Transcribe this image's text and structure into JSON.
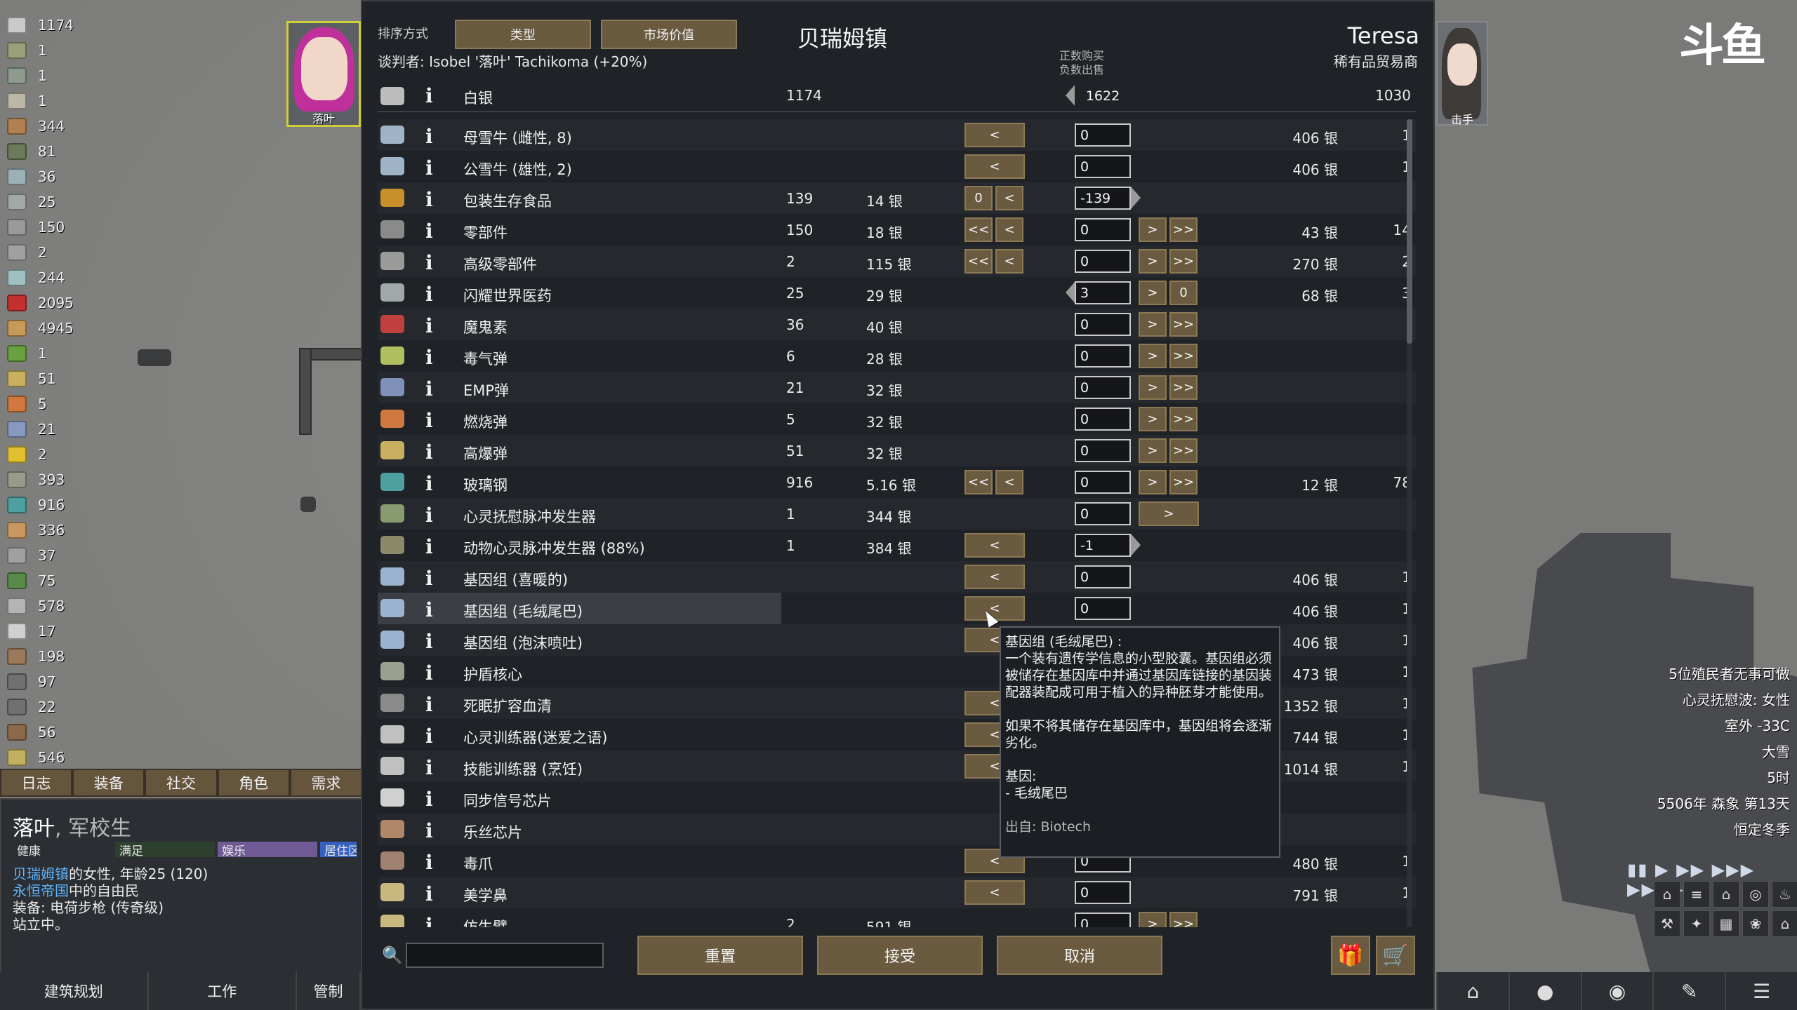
{
  "resources": [
    {
      "value": "1174",
      "icon": "silver-icon",
      "color": "#c9c9c9"
    },
    {
      "value": "1",
      "icon": "shield-belt-icon",
      "color": "#9aa07a"
    },
    {
      "value": "1",
      "icon": "helmet-icon",
      "color": "#8e9a8e"
    },
    {
      "value": "1",
      "icon": "blade-icon",
      "color": "#bdb7a8"
    },
    {
      "value": "344",
      "icon": "meat-icon",
      "color": "#b08050"
    },
    {
      "value": "81",
      "icon": "textile-icon",
      "color": "#6a7a5a"
    },
    {
      "value": "36",
      "icon": "medicine-icon",
      "color": "#9bb0b5"
    },
    {
      "value": "25",
      "icon": "glitter-medicine-icon",
      "color": "#a0a8a8"
    },
    {
      "value": "150",
      "icon": "component-icon",
      "color": "#9a9a9a"
    },
    {
      "value": "2",
      "icon": "advanced-component-icon",
      "color": "#a0a0a0"
    },
    {
      "value": "244",
      "icon": "vial-icon",
      "color": "#9fc0c0"
    },
    {
      "value": "2095",
      "icon": "rice-icon",
      "color": "#c23030"
    },
    {
      "value": "4945",
      "icon": "wood-icon",
      "color": "#c79a58"
    },
    {
      "value": "1",
      "icon": "plant-icon",
      "color": "#6aa040"
    },
    {
      "value": "51",
      "icon": "shell-icon",
      "color": "#c8b060"
    },
    {
      "value": "5",
      "icon": "incendiary-shell-icon",
      "color": "#d07840"
    },
    {
      "value": "21",
      "icon": "emp-shell-icon",
      "color": "#8899c0"
    },
    {
      "value": "2",
      "icon": "gold-icon",
      "color": "#e0c030"
    },
    {
      "value": "393",
      "icon": "stone-block-icon",
      "color": "#9a9a8a"
    },
    {
      "value": "916",
      "icon": "plasteel-icon",
      "color": "#4ea0a0"
    },
    {
      "value": "336",
      "icon": "steel-icon",
      "color": "#c89860"
    },
    {
      "value": "37",
      "icon": "bone-icon",
      "color": "#a0a0a0"
    },
    {
      "value": "75",
      "icon": "herbal-icon",
      "color": "#5a8a4a"
    },
    {
      "value": "578",
      "icon": "steel-bar-icon",
      "color": "#b4b4b4"
    },
    {
      "value": "17",
      "icon": "uranium-icon",
      "color": "#d0d0d0"
    },
    {
      "value": "198",
      "icon": "rifle-icon",
      "color": "#9a7a5a"
    },
    {
      "value": "97",
      "icon": "pistol-icon",
      "color": "#707070"
    },
    {
      "value": "22",
      "icon": "knife-icon",
      "color": "#707070"
    },
    {
      "value": "56",
      "icon": "club-icon",
      "color": "#8a6a4a"
    },
    {
      "value": "546",
      "icon": "chemfuel-icon",
      "color": "#c0b060"
    }
  ],
  "left_portrait": {
    "tag": "落叶"
  },
  "left_tabs": [
    "日志",
    "装备",
    "社交",
    "角色",
    "需求"
  ],
  "inspect": {
    "name": "落叶",
    "title": ", 军校生",
    "bars": [
      {
        "label": "健康",
        "color": "#3a4e3a"
      },
      {
        "label": "满足",
        "color": "#2d3f2f"
      },
      {
        "label": "娱乐",
        "color": "#6f5a95"
      },
      {
        "label": "居住区",
        "color": "#3560c0"
      }
    ],
    "line1_link": "贝瑞姆镇",
    "line1_rest": "的女性, 年龄25 (120)",
    "line2_link": "永恒帝国",
    "line2_rest": "中的自由民",
    "line3": "装备: 电荷步枪 (传奇级)",
    "line4": "站立中。"
  },
  "bottom_left": [
    "建筑规划",
    "工作",
    "管制"
  ],
  "right_portrait_tag": "击手",
  "watermark": "斗鱼",
  "alerts": [
    "5位殖民者无事可做",
    "心灵抚慰波: 女性",
    "室外 -33C",
    "大雪",
    "5时",
    "5506年 森象 第13天",
    "恒定冬季"
  ],
  "speed_controls": "▮▮  ▶  ▶▶  ▶▶▶  ▶▶▶▶",
  "trade": {
    "sort_label": "排序方式",
    "sort_buttons": [
      "类型",
      "市场价值"
    ],
    "town": "贝瑞姆镇",
    "negotiator": "谈判者: Isobel '落叶' Tachikoma (+20%)",
    "trader_name": "Teresa",
    "trader_type": "稀有品贸易商",
    "hint_line1": "正数购买",
    "hint_line2": "负数出售",
    "silver": {
      "name": "白银",
      "colony": "1174",
      "amount": "1622",
      "trader": "1030"
    },
    "rows": [
      {
        "name": "母雪牛 (雌性, 8)",
        "cq": "",
        "cp": "",
        "left": [
          "<"
        ],
        "val": "0",
        "right": [],
        "tp": "406 银",
        "tq": "1",
        "icon": "#a0b4c8"
      },
      {
        "name": "公雪牛 (雄性, 2)",
        "cq": "",
        "cp": "",
        "left": [
          "<"
        ],
        "val": "0",
        "right": [],
        "tp": "406 银",
        "tq": "1",
        "icon": "#a0b4c8"
      },
      {
        "name": "包装生存食品",
        "cq": "139",
        "cp": "14 银",
        "left": [
          "0",
          "<"
        ],
        "val": "-139",
        "right": [],
        "tp": "",
        "tq": "",
        "icon": "#c8902a",
        "rarrow": true
      },
      {
        "name": "零部件",
        "cq": "150",
        "cp": "18 银",
        "left": [
          "<<",
          "<"
        ],
        "val": "0",
        "right": [
          ">",
          ">>"
        ],
        "tp": "43 银",
        "tq": "14",
        "icon": "#8a8a8a"
      },
      {
        "name": "高级零部件",
        "cq": "2",
        "cp": "115 银",
        "left": [
          "<<",
          "<"
        ],
        "val": "0",
        "right": [
          ">",
          ">>"
        ],
        "tp": "270 银",
        "tq": "2",
        "icon": "#9a9a9a"
      },
      {
        "name": "闪耀世界医药",
        "cq": "25",
        "cp": "29 银",
        "left": [],
        "val": "3",
        "right": [
          ">",
          "0"
        ],
        "tp": "68 银",
        "tq": "3",
        "icon": "#a0a8a8",
        "larrow": true
      },
      {
        "name": "魔鬼素",
        "cq": "36",
        "cp": "40 银",
        "left": [],
        "val": "0",
        "right": [
          ">",
          ">>"
        ],
        "tp": "",
        "tq": "",
        "icon": "#c04040"
      },
      {
        "name": "毒气弹",
        "cq": "6",
        "cp": "28 银",
        "left": [],
        "val": "0",
        "right": [
          ">",
          ">>"
        ],
        "tp": "",
        "tq": "",
        "icon": "#b0c060"
      },
      {
        "name": "EMP弹",
        "cq": "21",
        "cp": "32 银",
        "left": [],
        "val": "0",
        "right": [
          ">",
          ">>"
        ],
        "tp": "",
        "tq": "",
        "icon": "#8090b8"
      },
      {
        "name": "燃烧弹",
        "cq": "5",
        "cp": "32 银",
        "left": [],
        "val": "0",
        "right": [
          ">",
          ">>"
        ],
        "tp": "",
        "tq": "",
        "icon": "#d07840"
      },
      {
        "name": "高爆弹",
        "cq": "51",
        "cp": "32 银",
        "left": [],
        "val": "0",
        "right": [
          ">",
          ">>"
        ],
        "tp": "",
        "tq": "",
        "icon": "#c8b060"
      },
      {
        "name": "玻璃钢",
        "cq": "916",
        "cp": "5.16 银",
        "left": [
          "<<",
          "<"
        ],
        "val": "0",
        "right": [
          ">",
          ">>"
        ],
        "tp": "12 银",
        "tq": "78",
        "icon": "#4ea0a0"
      },
      {
        "name": "心灵抚慰脉冲发生器",
        "cq": "1",
        "cp": "344 银",
        "left": [],
        "val": "0",
        "right": [
          ">"
        ],
        "tp": "",
        "tq": "",
        "icon": "#8a9a70"
      },
      {
        "name": "动物心灵脉冲发生器 (88%)",
        "cq": "1",
        "cp": "384 银",
        "left": [
          "<"
        ],
        "val": "-1",
        "right": [],
        "tp": "",
        "tq": "",
        "icon": "#8a8a6a",
        "rarrow": true
      },
      {
        "name": "基因组 (喜暖的)",
        "cq": "",
        "cp": "",
        "left": [
          "<"
        ],
        "val": "0",
        "right": [],
        "tp": "406 银",
        "tq": "1",
        "icon": "#9ab4d0"
      },
      {
        "name": "基因组 (毛绒尾巴)",
        "cq": "",
        "cp": "",
        "left": [
          "<"
        ],
        "val": "0",
        "right": [],
        "tp": "406 银",
        "tq": "1",
        "icon": "#9ab4d0",
        "hl": true
      },
      {
        "name": "基因组 (泡沫喷吐)",
        "cq": "",
        "cp": "",
        "left": [
          "<"
        ],
        "val": "0",
        "right": [],
        "tp": "406 银",
        "tq": "1",
        "icon": "#9ab4d0"
      },
      {
        "name": "护盾核心",
        "cq": "",
        "cp": "",
        "left": [],
        "val": "1",
        "right": [
          ">"
        ],
        "tp": "473 银",
        "tq": "1",
        "icon": "#9aa090",
        "larrow": true
      },
      {
        "name": "死眠扩容血清",
        "cq": "",
        "cp": "",
        "left": [
          "<"
        ],
        "val": "0",
        "right": [],
        "tp": "1352 银",
        "tq": "1",
        "icon": "#8a8a8a"
      },
      {
        "name": "心灵训练器(迷爱之语)",
        "cq": "",
        "cp": "",
        "left": [
          "<"
        ],
        "val": "0",
        "right": [],
        "tp": "744 银",
        "tq": "1",
        "icon": "#c0c0c0"
      },
      {
        "name": "技能训练器 (烹饪)",
        "cq": "",
        "cp": "",
        "left": [
          "<"
        ],
        "val": "0",
        "right": [],
        "tp": "1014 银",
        "tq": "1",
        "icon": "#c0c0c0"
      },
      {
        "name": "同步信号芯片",
        "cq": "",
        "cp": "",
        "left": [],
        "val": "0",
        "right": [
          ">",
          ">>"
        ],
        "tp": "",
        "tq": "",
        "icon": "#d0d0d0"
      },
      {
        "name": "乐丝芯片",
        "cq": "",
        "cp": "",
        "left": [],
        "val": "0",
        "right": [
          ">"
        ],
        "tp": "",
        "tq": "",
        "icon": "#b08868"
      },
      {
        "name": "毒爪",
        "cq": "",
        "cp": "",
        "left": [
          "<"
        ],
        "val": "0",
        "right": [],
        "tp": "480 银",
        "tq": "1",
        "icon": "#a08070"
      },
      {
        "name": "美学鼻",
        "cq": "",
        "cp": "",
        "left": [
          "<"
        ],
        "val": "0",
        "right": [],
        "tp": "791 银",
        "tq": "1",
        "icon": "#c8b880"
      },
      {
        "name": "仿生臂",
        "cq": "2",
        "cp": "591 银",
        "left": [],
        "val": "0",
        "right": [
          ">",
          ">>"
        ],
        "tp": "",
        "tq": "",
        "icon": "#c8b880"
      }
    ],
    "tooltip": {
      "title": "基因组 (毛绒尾巴) :",
      "body": "一个装有遗传学信息的小型胶囊。基因组必须被储存在基因库中并通过基因库链接的基因装配器装配成可用于植入的异种胚芽才能使用。",
      "note": "如果不将其储存在基因库中，基因组将会逐渐劣化。",
      "genes_label": "基因:",
      "gene": " - 毛绒尾巴",
      "source": "出自: Biotech"
    },
    "search_placeholder": "",
    "actions": [
      "重置",
      "接受",
      "取消"
    ]
  }
}
